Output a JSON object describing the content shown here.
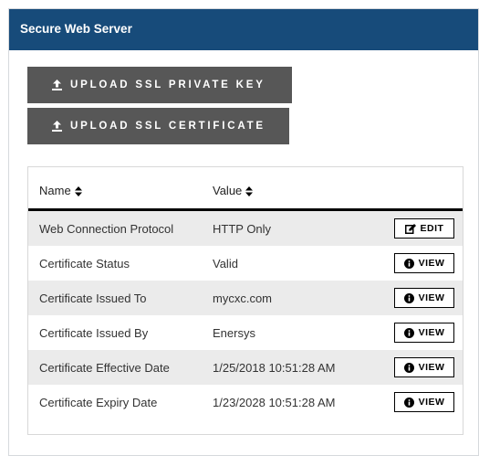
{
  "colors": {
    "header": "#174b7a",
    "button": "#575757",
    "row_alt": "#ebebeb"
  },
  "panel": {
    "title": "Secure Web Server"
  },
  "buttons": {
    "upload_key": {
      "label": "UPLOAD SSL PRIVATE KEY",
      "icon": "upload-icon"
    },
    "upload_cert": {
      "label": "UPLOAD SSL CERTIFICATE",
      "icon": "upload-icon"
    }
  },
  "table": {
    "columns": [
      {
        "label": "Name",
        "icon": "sort-icon"
      },
      {
        "label": "Value",
        "icon": "sort-icon"
      }
    ],
    "rows": [
      {
        "name": "Web Connection Protocol",
        "value": "HTTP Only",
        "action": "EDIT",
        "action_icon": "edit-icon"
      },
      {
        "name": "Certificate Status",
        "value": "Valid",
        "action": "VIEW",
        "action_icon": "info-icon"
      },
      {
        "name": "Certificate Issued To",
        "value": "mycxc.com",
        "action": "VIEW",
        "action_icon": "info-icon"
      },
      {
        "name": "Certificate Issued By",
        "value": "Enersys",
        "action": "VIEW",
        "action_icon": "info-icon"
      },
      {
        "name": "Certificate Effective Date",
        "value": "1/25/2018 10:51:28 AM",
        "action": "VIEW",
        "action_icon": "info-icon"
      },
      {
        "name": "Certificate Expiry Date",
        "value": "1/23/2028 10:51:28 AM",
        "action": "VIEW",
        "action_icon": "info-icon"
      }
    ]
  }
}
